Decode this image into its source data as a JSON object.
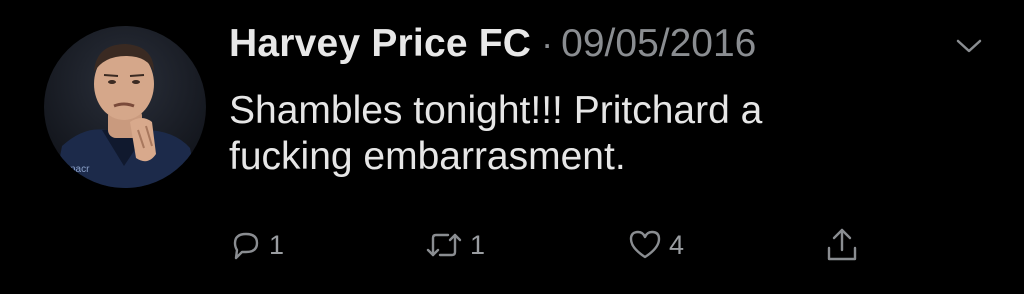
{
  "tweet": {
    "author": {
      "display_name": "Harvey Price FC",
      "avatar_icon": "profile-photo"
    },
    "separator": "·",
    "date": "09/05/2016",
    "text_lines": [
      "Shambles tonight!!! Pritchard a",
      "fucking embarrasment."
    ],
    "actions": {
      "reply_count": "1",
      "retweet_count": "1",
      "like_count": "4"
    },
    "colors": {
      "background": "#000000",
      "text": "#e6e6e6",
      "secondary": "#8a8d91"
    }
  }
}
